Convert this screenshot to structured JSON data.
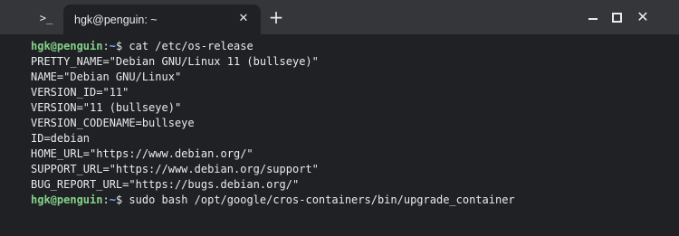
{
  "app": {
    "icon": "terminal-prompt-icon",
    "icon_glyph": ">_"
  },
  "tab": {
    "title": "hgk@penguin: ~",
    "close_glyph": "✕"
  },
  "controls": {
    "new_tab_glyph": "+",
    "close_glyph": "✕"
  },
  "terminal": {
    "prompt": {
      "user_host": "hgk@penguin",
      "colon": ":",
      "path": "~",
      "sign": "$ "
    },
    "commands": [
      "cat /etc/os-release",
      "sudo bash /opt/google/cros-containers/bin/upgrade_container"
    ],
    "output": [
      "PRETTY_NAME=\"Debian GNU/Linux 11 (bullseye)\"",
      "NAME=\"Debian GNU/Linux\"",
      "VERSION_ID=\"11\"",
      "VERSION=\"11 (bullseye)\"",
      "VERSION_CODENAME=bullseye",
      "ID=debian",
      "HOME_URL=\"https://www.debian.org/\"",
      "SUPPORT_URL=\"https://www.debian.org/support\"",
      "BUG_REPORT_URL=\"https://bugs.debian.org/\""
    ]
  },
  "colors": {
    "background": "#202124",
    "titlebar": "#35363a",
    "text": "#e8eaed",
    "prompt_user": "#85d18a",
    "prompt_path": "#7bb2f8"
  }
}
